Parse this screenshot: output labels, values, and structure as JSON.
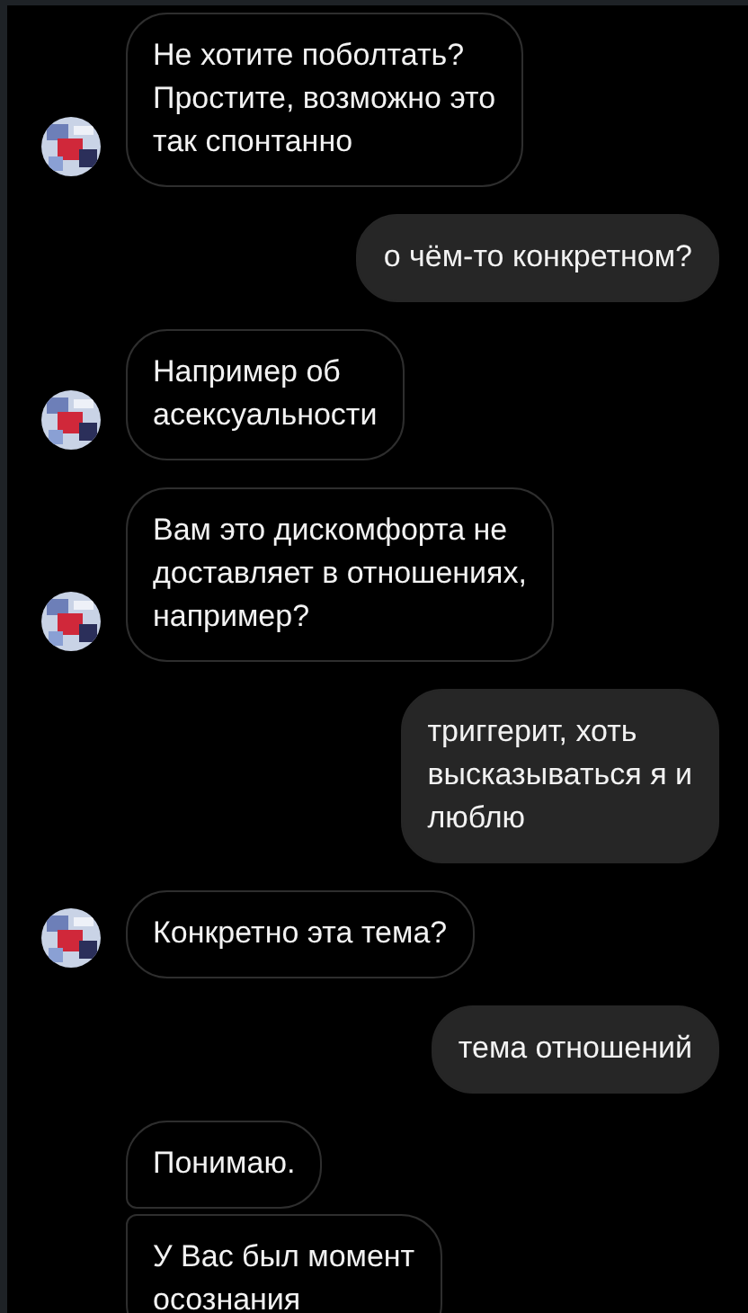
{
  "messages": [
    {
      "kind": "received",
      "avatar": true,
      "lines": [
        "Не хотите поболтать?",
        "Простите, возможно это",
        "так спонтанно"
      ]
    },
    {
      "kind": "sent",
      "lines": [
        "о чём-то конкретном?"
      ]
    },
    {
      "kind": "received",
      "avatar": true,
      "lines": [
        "Например об",
        "асексуальности"
      ]
    },
    {
      "kind": "received",
      "avatar": true,
      "lines": [
        "Вам это дискомфорта не",
        "доставляет в отношениях,",
        "например?"
      ]
    },
    {
      "kind": "sent",
      "lines": [
        "триггерит, хоть",
        "высказываться я и",
        "люблю"
      ]
    },
    {
      "kind": "received",
      "avatar": true,
      "lines": [
        "Конкретно эта тема?"
      ]
    },
    {
      "kind": "sent",
      "lines": [
        "тема отношений"
      ]
    },
    {
      "kind": "received",
      "avatar": false,
      "lines": [
        "Понимаю."
      ]
    },
    {
      "kind": "received",
      "avatar": false,
      "lines": [
        "У Вас был момент",
        "осознания"
      ]
    }
  ]
}
